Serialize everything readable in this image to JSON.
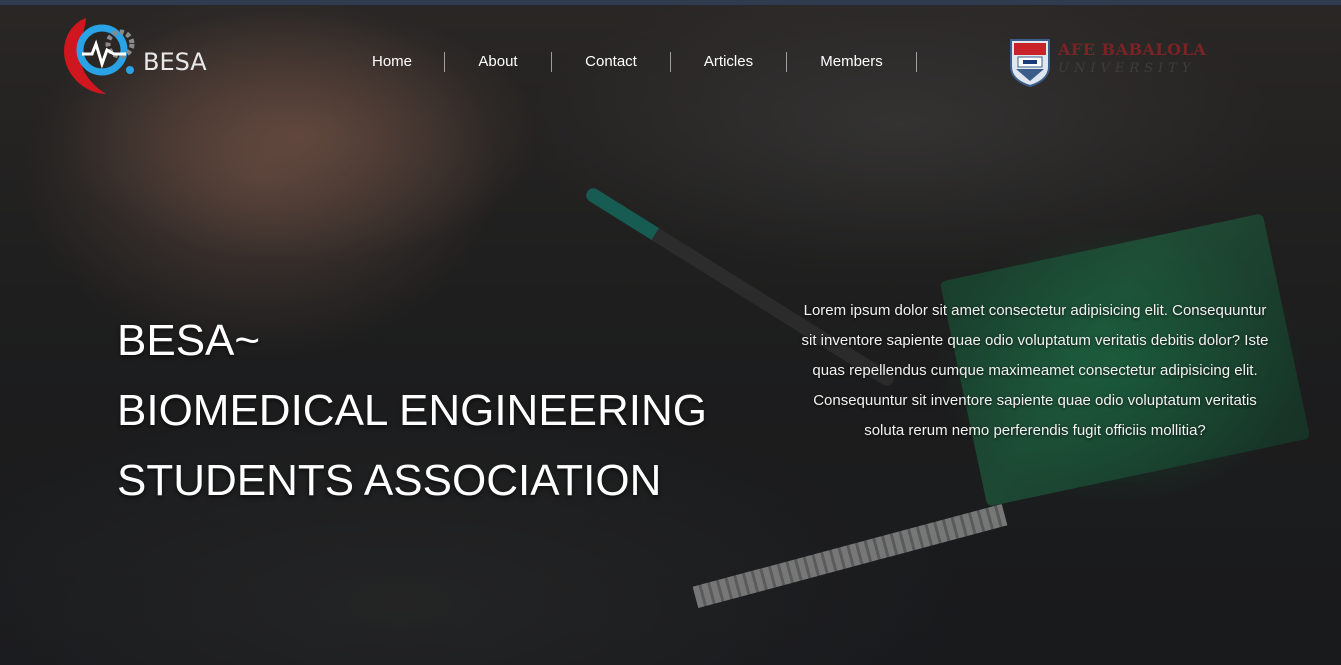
{
  "brand": {
    "name": "BESA",
    "primary_color": "#d0171f",
    "secondary_color": "#2aa3e6"
  },
  "nav": {
    "items": [
      "Home",
      "About",
      "Contact",
      "Articles",
      "Members"
    ]
  },
  "university": {
    "name": "AFE BABALOLA",
    "subtitle": "UNIVERSITY",
    "color": "#7b2324"
  },
  "hero": {
    "title_lines": [
      "BESA~",
      "BIOMEDICAL ENGINEERING",
      "STUDENTS ASSOCIATION"
    ],
    "description": "Lorem ipsum dolor sit amet consectetur adipisicing elit. Consequuntur sit inventore sapiente quae odio voluptatum veritatis debitis dolor? Iste quas repellendus cumque maximeamet consectetur adipisicing elit. Consequuntur sit inventore sapiente quae odio voluptatum veritatis soluta rerum nemo perferendis fugit officiis mollitia?"
  },
  "icons": {
    "logo": "besa-logo-icon",
    "crest": "university-crest-icon"
  }
}
